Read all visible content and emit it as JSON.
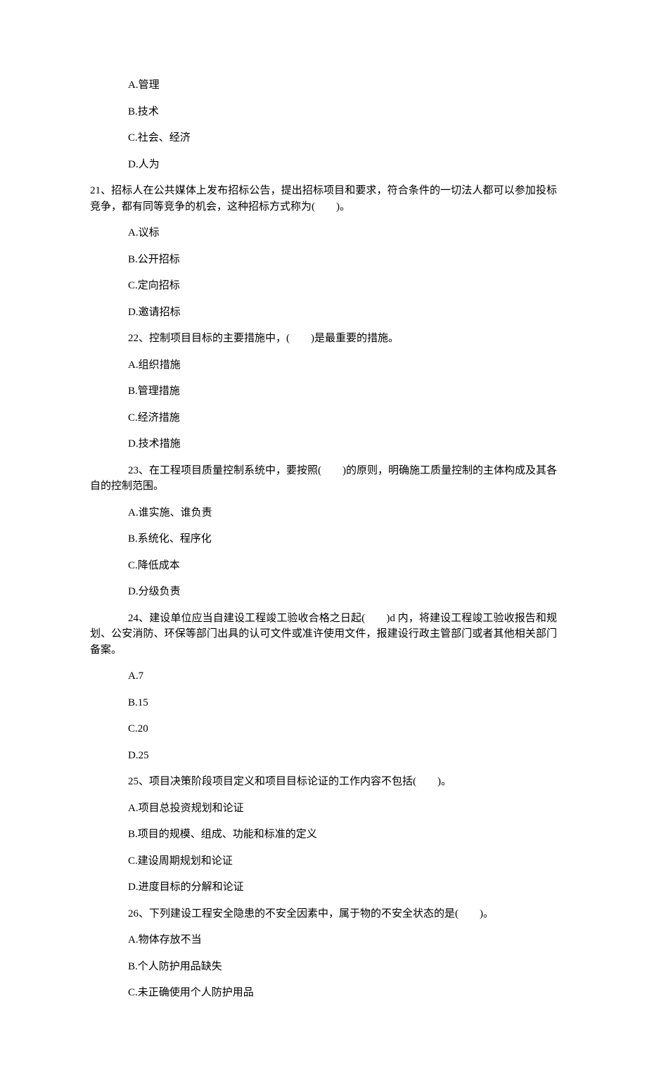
{
  "q20_options": {
    "a": "A.管理",
    "b": "B.技术",
    "c": "C.社会、经济",
    "d": "D.人为"
  },
  "q21": {
    "stem": "21、招标人在公共媒体上发布招标公告，提出招标项目和要求，符合条件的一切法人都可以参加投标竞争，都有同等竞争的机会，这种招标方式称为(　　)。",
    "a": "A.议标",
    "b": "B.公开招标",
    "c": "C.定向招标",
    "d": "D.邀请招标"
  },
  "q22": {
    "stem": "22、控制项目目标的主要措施中，(　　)是最重要的措施。",
    "a": "A.组织措施",
    "b": "B.管理措施",
    "c": "C.经济措施",
    "d": "D.技术措施"
  },
  "q23": {
    "stem": "23、在工程项目质量控制系统中，要按照(　　)的原则，明确施工质量控制的主体构成及其各自的控制范围。",
    "a": "A.谁实施、谁负责",
    "b": "B.系统化、程序化",
    "c": "C.降低成本",
    "d": "D.分级负责"
  },
  "q24": {
    "stem": "24、建设单位应当自建设工程竣工验收合格之日起(　　)d 内，将建设工程竣工验收报告和规划、公安消防、环保等部门出具的认可文件或准许使用文件，报建设行政主管部门或者其他相关部门备案。",
    "a": "A.7",
    "b": "B.15",
    "c": "C.20",
    "d": "D.25"
  },
  "q25": {
    "stem": "25、项目决策阶段项目定义和项目目标论证的工作内容不包括(　　)。",
    "a": "A.项目总投资规划和论证",
    "b": "B.项目的规模、组成、功能和标准的定义",
    "c": "C.建设周期规划和论证",
    "d": "D.进度目标的分解和论证"
  },
  "q26": {
    "stem": "26、下列建设工程安全隐患的不安全因素中，属于物的不安全状态的是(　　)。",
    "a": "A.物体存放不当",
    "b": "B.个人防护用品缺失",
    "c": "C.未正确使用个人防护用品"
  }
}
